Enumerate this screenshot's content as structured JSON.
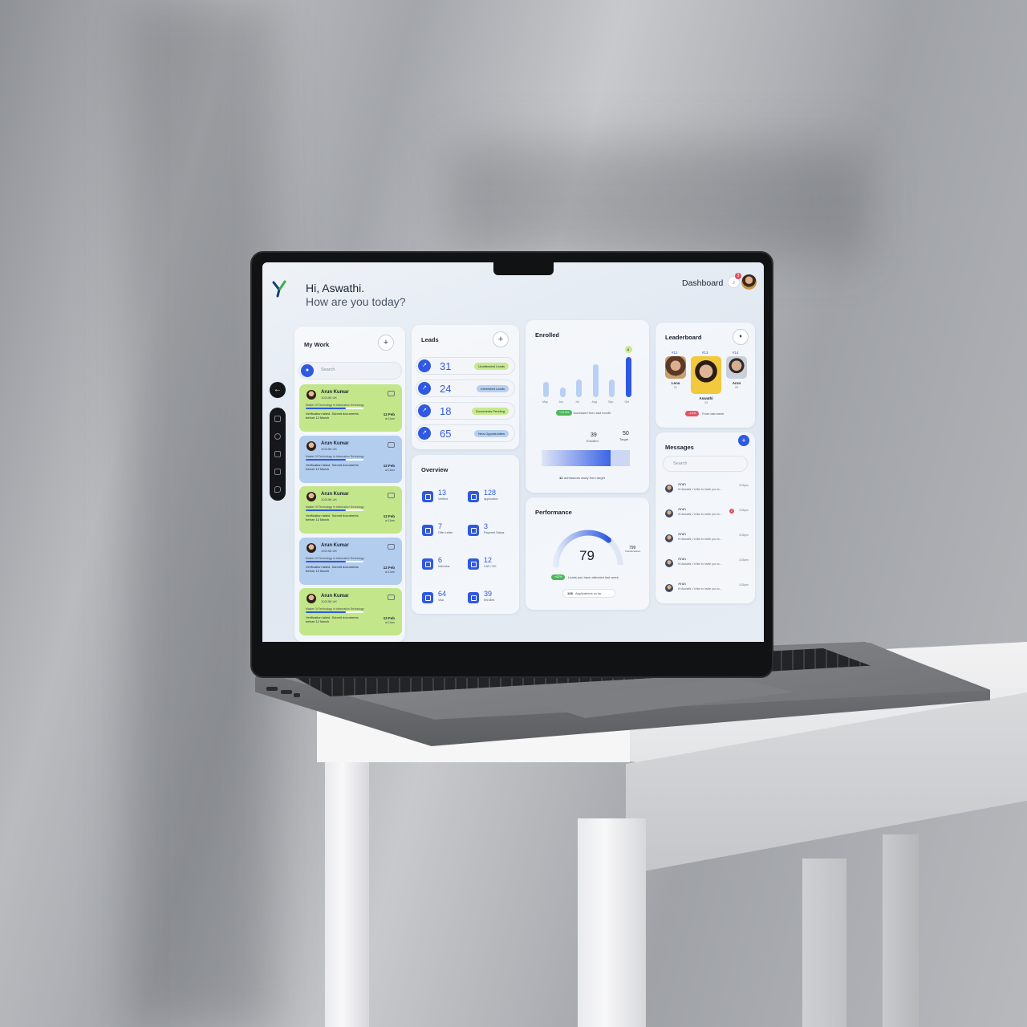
{
  "header": {
    "greeting": "Hi, Aswathi.",
    "subtitle": "How are you today?",
    "nav_title": "Dashboard",
    "notification_count": "3"
  },
  "my_work": {
    "title": "My Work",
    "search_placeholder": "Search",
    "items": [
      {
        "name": "Arun Kumar",
        "id": "102156 UK",
        "course": "Master Of Technology In Information Technology",
        "status": "Verification failed. Submit documents before 12 March",
        "date": "12 Feb",
        "time": "at 11am",
        "color": "green"
      },
      {
        "name": "Arun Kumar",
        "id": "102156 UK",
        "course": "Master Of Technology In Information Technology",
        "status": "Verification failed. Submit documents before 12 March",
        "date": "12 Feb",
        "time": "at 11am",
        "color": "blue"
      },
      {
        "name": "Arun Kumar",
        "id": "102156 UK",
        "course": "Master Of Technology In Information Technology",
        "status": "Verification failed. Submit documents before 12 March",
        "date": "12 Feb",
        "time": "at 11am",
        "color": "green"
      },
      {
        "name": "Arun Kumar",
        "id": "102156 UK",
        "course": "Master Of Technology In Information Technology",
        "status": "Verification failed. Submit documents before 12 March",
        "date": "12 Feb",
        "time": "at 11am",
        "color": "blue"
      },
      {
        "name": "Arun Kumar",
        "id": "102156 UK",
        "course": "Master Of Technology In Information Technology",
        "status": "Verification failed. Submit documents before 12 March",
        "date": "12 Feb",
        "time": "at 11am",
        "color": "green"
      }
    ]
  },
  "leads": {
    "title": "Leads",
    "rows": [
      {
        "value": "31",
        "label": "Unattended Leads",
        "tag_color": "#c6ea8c"
      },
      {
        "value": "24",
        "label": "Interested Leads",
        "tag_color": "#b6d0f2"
      },
      {
        "value": "18",
        "label": "Documents Pending",
        "tag_color": "#c6ea8c"
      },
      {
        "value": "65",
        "label": "New Opportunities",
        "tag_color": "#b6d0f2"
      }
    ]
  },
  "overview": {
    "title": "Overview",
    "items": [
      {
        "value": "13",
        "label": "Verified"
      },
      {
        "value": "128",
        "label": "Application"
      },
      {
        "value": "7",
        "label": "Offer Letter"
      },
      {
        "value": "3",
        "label": "Payment Status"
      },
      {
        "value": "6",
        "label": "Interview"
      },
      {
        "value": "12",
        "label": "CAS / I20"
      },
      {
        "value": "64",
        "label": "Visa"
      },
      {
        "value": "39",
        "label": "Enrolled"
      }
    ]
  },
  "enrolled": {
    "title": "Enrolled",
    "change_pill": "+12.5%",
    "change_text": "Increased from last month",
    "enrolled_value": "39",
    "enrolled_label": "Enrolled",
    "target_value": "50",
    "target_label": "Target",
    "progress_fraction": 0.78,
    "away_count": "11",
    "away_text": "admissions away from target",
    "peak_marker": "8"
  },
  "chart_data": {
    "type": "bar",
    "categories": [
      "May",
      "Jun",
      "Jul",
      "Aug",
      "Sep",
      "Oct"
    ],
    "values": [
      3,
      2,
      3.5,
      6.5,
      3.5,
      8
    ],
    "highlight_index": 5,
    "title": "Enrolled",
    "xlabel": "",
    "ylabel": ""
  },
  "performance": {
    "title": "Performance",
    "value": "79",
    "max_value": "799",
    "max_label": "Total Admissions",
    "fill_fraction": 0.72,
    "change_pill": "+42%",
    "change_text": "Leads you have attended last week",
    "footer_count": "128",
    "footer_text": "Applications so far"
  },
  "leaderboard": {
    "title": "Leaderboard",
    "people": [
      {
        "rank": "#12",
        "name": "Lena",
        "score": "21"
      },
      {
        "rank": "#13",
        "name": "Aswathi",
        "score": "23"
      },
      {
        "rank": "#14",
        "name": "Arun",
        "score": "25"
      }
    ],
    "change_pill": "-1.5%",
    "change_text": "From last week"
  },
  "messages": {
    "title": "Messages",
    "search_placeholder": "Search",
    "items": [
      {
        "name": "Arun",
        "text": "Hi Aswathi, I'd like to invite you to...",
        "time": "3:35pm",
        "unread": ""
      },
      {
        "name": "Arun",
        "text": "Hi Aswathi, I'd like to invite you to...",
        "time": "3:35pm",
        "unread": "2"
      },
      {
        "name": "Arun",
        "text": "Hi Aswathi, I'd like to invite you to...",
        "time": "3:35pm",
        "unread": ""
      },
      {
        "name": "Arun",
        "text": "Hi Aswathi, I'd like to invite you to...",
        "time": "3:35pm",
        "unread": ""
      },
      {
        "name": "Arun",
        "text": "Hi Aswathi, I'd like to invite you to...",
        "time": "3:35pm",
        "unread": ""
      }
    ]
  },
  "colors": {
    "accent": "#2f59e0",
    "green_card": "#c4e68a",
    "blue_card": "#b3cdee",
    "alert": "#e24c5d"
  }
}
